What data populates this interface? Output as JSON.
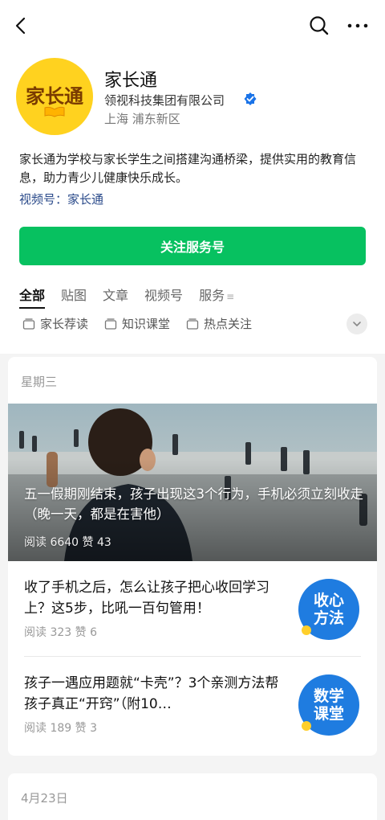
{
  "account": {
    "name": "家长通",
    "avatar_text": "家长通",
    "org": "领视科技集团有限公司",
    "location": "上海 浦东新区",
    "description": "家长通为学校与家长学生之间搭建沟通桥梁，提供实用的教育信息，助力青少儿健康快乐成长。",
    "channel": "视频号：家长通",
    "follow_label": "关注服务号"
  },
  "tabs": [
    {
      "label": "全部",
      "active": true
    },
    {
      "label": "贴图",
      "active": false
    },
    {
      "label": "文章",
      "active": false
    },
    {
      "label": "视频号",
      "active": false
    },
    {
      "label": "服务",
      "active": false
    }
  ],
  "tab_menu_glyph": "≡",
  "subtabs": [
    "家长荐读",
    "知识课堂",
    "热点关注"
  ],
  "feed": {
    "group1": {
      "date": "星期三",
      "hero": {
        "title": "五一假期刚结束，孩子出现这3个行为，手机必须立刻收走（晚一天，都是在害他）",
        "stats": "阅读 6640  赞 43"
      },
      "articles": [
        {
          "title": "收了手机之后，怎么让孩子把心收回学习上？这5步，比吼一百句管用！",
          "stats": "阅读 323  赞 6",
          "thumb_text": "收心方法"
        },
        {
          "title": "孩子一遇应用题就“卡壳”？3个亲测方法帮孩子真正“开窍”（附10…",
          "stats": "阅读 189  赞 3",
          "thumb_text": "数学课堂"
        }
      ]
    },
    "group2": {
      "date": "4月23日"
    }
  },
  "colors": {
    "brand_green": "#07c160",
    "link_blue": "#2a4a8a",
    "verified_blue": "#1a73e8",
    "avatar_yellow": "#ffd21f",
    "thumb_blue": "#1f7ce0"
  },
  "icons": [
    "back-arrow-icon",
    "search-icon",
    "more-icon",
    "verified-icon",
    "book-icon",
    "chevron-down-icon"
  ]
}
